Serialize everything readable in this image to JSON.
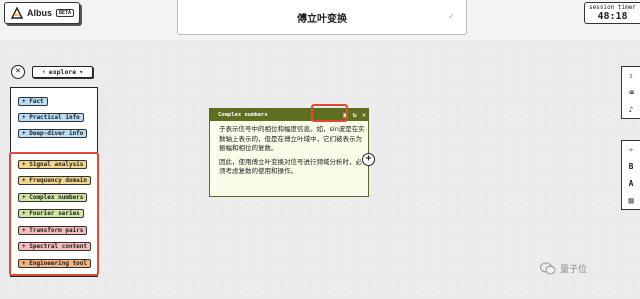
{
  "app": {
    "name": "Albus",
    "badge": "BETA"
  },
  "header": {
    "title": "傅立叶变换",
    "check_icon": "check-icon"
  },
  "session": {
    "label": "session timer",
    "value": "48:18"
  },
  "controls": {
    "close_symbol": "✕",
    "explore_label": "explore",
    "explore_icon": "lightning-icon"
  },
  "left_panel": {
    "top_items": [
      {
        "label": "+ Fact",
        "color": "#b9def5"
      },
      {
        "label": "+ Practical info",
        "color": "#b9def5"
      },
      {
        "label": "+ Deep-diver info",
        "color": "#b9def5"
      }
    ],
    "concept_items": [
      {
        "label": "+ Signal analysis",
        "color": "#f4d68a"
      },
      {
        "label": "+ Frequency domain",
        "color": "#f4d68a"
      },
      {
        "label": "+ Complex numbers",
        "color": "#cfe6a2"
      },
      {
        "label": "+ Fourier series",
        "color": "#cfe6a2"
      },
      {
        "label": "+ Transform pairs",
        "color": "#f7bcbc"
      },
      {
        "label": "+ Spectral content",
        "color": "#f7bcbc"
      },
      {
        "label": "+ Engineering tool",
        "color": "#f3b27e"
      }
    ]
  },
  "popup": {
    "title": "Complex numbers",
    "paragraph1": "于表示信号中的相位和幅度信息。如，sin波是在实数轴上表示的，但是在傅立叶域中，它们被表示为振幅和相位的复数。",
    "paragraph2": "因此，使用傅立叶变换对信号进行频域分析时，必须考虑复数的使用和操作。"
  },
  "right_toolbar": {
    "group1": [
      "share-icon",
      "eraser-icon",
      "music-note-icon"
    ],
    "group2": [
      "magic-wand-icon",
      "bold-icon",
      "text-icon",
      "image-icon"
    ]
  },
  "watermark": {
    "text": "量子位"
  },
  "colors": {
    "accent_red": "#e24a35",
    "popup_header": "#5f6f20"
  }
}
